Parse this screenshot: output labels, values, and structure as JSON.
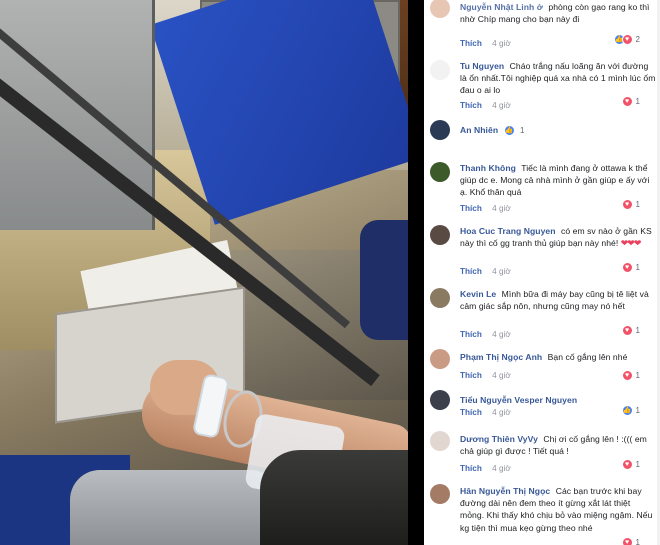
{
  "comments": [
    {
      "author": "",
      "text": "phòng còn gạo rang ko thì nhờ Chíp mang cho bạn này đi",
      "head_fragment": "Nguyễn Nhật Linh ở",
      "like_label": "Thích",
      "time": "4 giờ",
      "reactions": [
        "like",
        "heart"
      ],
      "count": "2",
      "avatar_color": "#e8c6b4"
    },
    {
      "author": "Tu Nguyen",
      "text": "Cháo trắng nấu loãng ăn với đường là ổn nhất.Tôi nghiệp quá xa nhà có 1 mình lúc ốm đau o ai lo",
      "like_label": "Thích",
      "time": "4 giờ",
      "reactions": [
        "heart"
      ],
      "count": "1",
      "avatar_color": "#f2f2f2"
    },
    {
      "author": "An Nhiên",
      "text": "",
      "like_label": "",
      "time": "",
      "reactions": [
        "like"
      ],
      "count": "1",
      "avatar_color": "#2b3b55"
    },
    {
      "author": "Thanh Không",
      "text": "Tiếc là mình đang ở ottawa k thể giúp dc e. Mong cả nhà mình ở gần giúp e ấy với ạ. Khổ thân quá",
      "like_label": "Thích",
      "time": "4 giờ",
      "reactions": [
        "heart"
      ],
      "count": "1",
      "avatar_color": "#3d5a2a"
    },
    {
      "author": "Hoa Cuc Trang Nguyen",
      "text": "có em sv nào ở gần KS này thì cố gg tranh thủ giúp bạn này nhé!",
      "hearts": "❤❤❤",
      "like_label": "Thích",
      "time": "4 giờ",
      "reactions": [
        "heart"
      ],
      "count": "1",
      "avatar_color": "#5a4a44"
    },
    {
      "author": "Kevin Le",
      "text": "Mình bữa đi máy bay cũng bị tê liệt và cảm giác sắp nôn, nhưng cũng may nó hết",
      "like_label": "Thích",
      "time": "4 giờ",
      "reactions": [
        "heart"
      ],
      "count": "1",
      "avatar_color": "#8a7a62"
    },
    {
      "author": "Phạm Thị Ngọc Anh",
      "text": "Bạn cố gắng lên nhé",
      "like_label": "Thích",
      "time": "4 giờ",
      "reactions": [
        "heart"
      ],
      "count": "1",
      "avatar_color": "#c99a84"
    },
    {
      "author": "Tiểu Nguyễn Vesper Nguyen",
      "text": "",
      "like_label": "Thích",
      "time": "4 giờ",
      "reactions": [
        "like"
      ],
      "count": "1",
      "avatar_color": "#3a3f4a"
    },
    {
      "author": "Dương Thiên VyVy",
      "text": "Chị ơi cố gắng lên ! :((( em chả giúp gì được ! Tiết quá !",
      "like_label": "Thích",
      "time": "4 giờ",
      "reactions": [
        "heart"
      ],
      "count": "1",
      "avatar_color": "#e2d6d0"
    },
    {
      "author": "Hân Nguyễn Thị Ngọc",
      "text": "Các bạn trước khi bay đường dài nên đem theo ít gừng xắt lát thiệt mỏng. Khi thấy khó chịu bỏ vào miệng ngậm. Nếu kg tiện thì mua kẹo gừng theo nhé",
      "like_label": "",
      "time": "",
      "reactions": [
        "heart"
      ],
      "count": "1",
      "avatar_color": "#a47c66"
    }
  ]
}
